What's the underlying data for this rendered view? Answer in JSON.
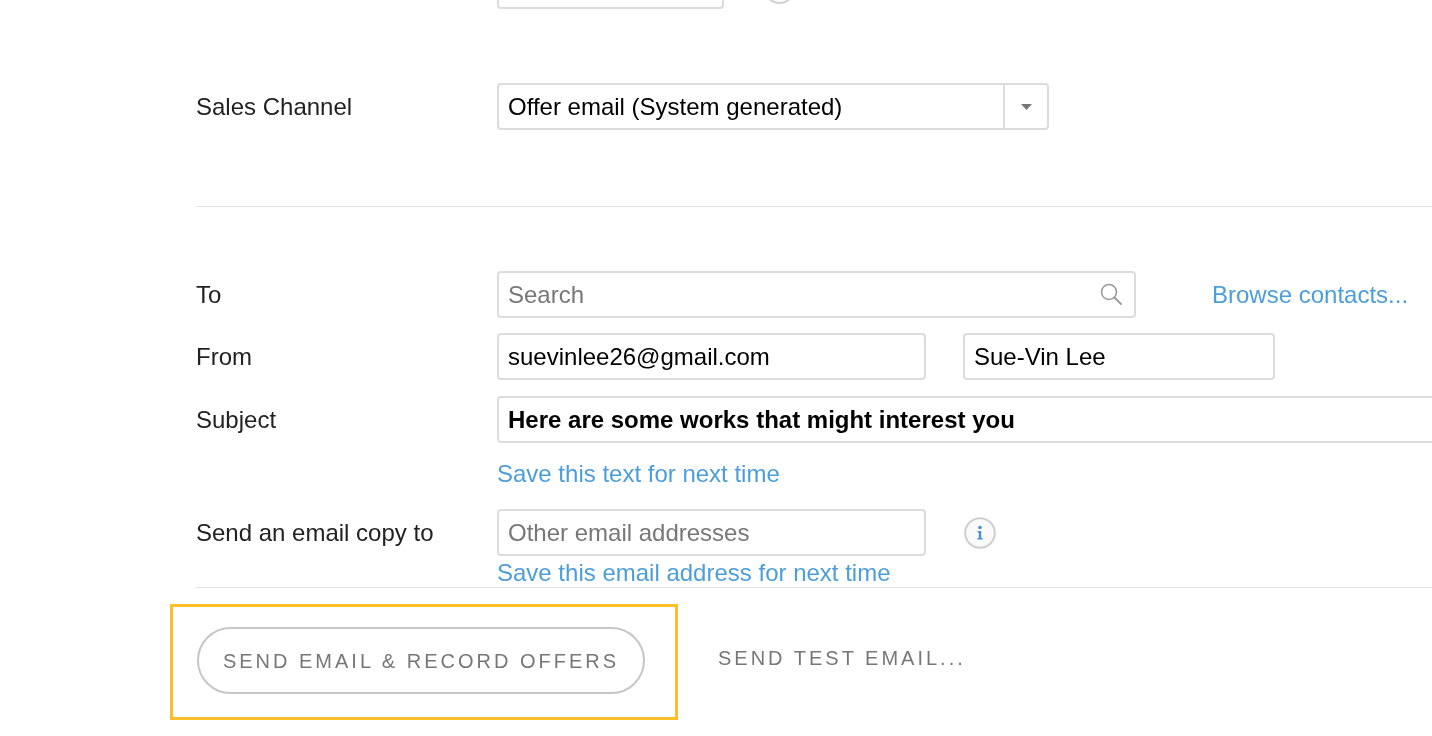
{
  "sales_channel": {
    "label": "Sales Channel",
    "value": "Offer email (System generated)"
  },
  "to": {
    "label": "To",
    "placeholder": "Search",
    "link": "Browse contacts..."
  },
  "from": {
    "label": "From",
    "email": "suevinlee26@gmail.com",
    "name": "Sue-Vin Lee"
  },
  "subject": {
    "label": "Subject",
    "value": "Here are some works that might interest you",
    "link": "Save this text for next time"
  },
  "email_copy": {
    "label": "Send an email copy to",
    "placeholder": "Other email addresses",
    "link": "Save this email address for next time"
  },
  "actions": [
    {
      "label": "SEND EMAIL & RECORD OFFERS",
      "kind": "outlined",
      "highlighted": true
    },
    {
      "label": "SEND TEST EMAIL...",
      "kind": "text",
      "highlighted": false
    }
  ]
}
